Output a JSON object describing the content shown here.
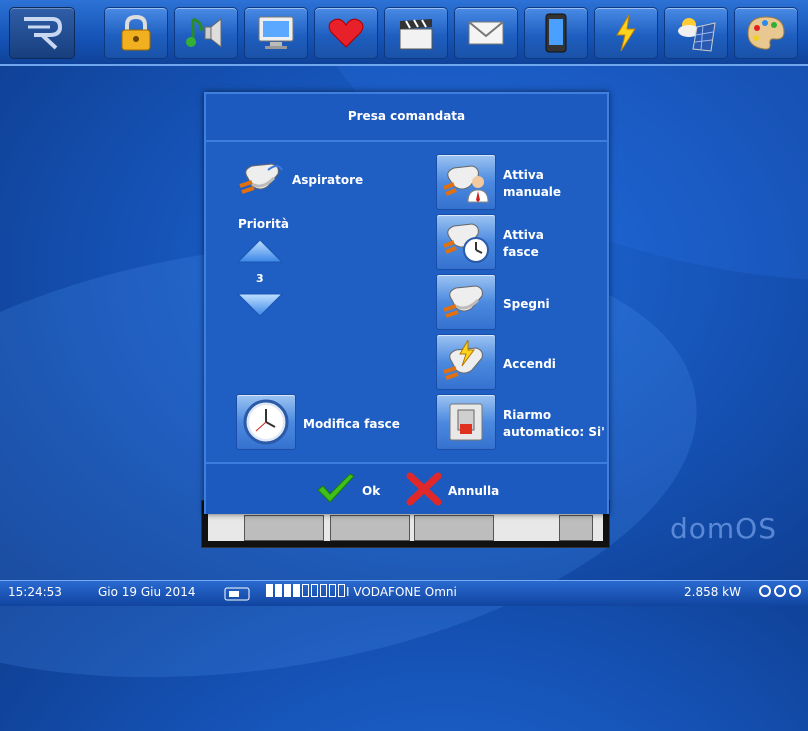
{
  "topbar": {
    "logo": "domos-logo",
    "icons": [
      "lock-icon",
      "music-icon",
      "monitor-icon",
      "heart-icon",
      "clapperboard-icon",
      "mail-icon",
      "phone-icon",
      "lightning-icon",
      "weather-solar-icon",
      "palette-icon"
    ]
  },
  "dialog": {
    "title": "Presa comandata",
    "device_name": "Aspiratore",
    "priority_label": "Priorità",
    "priority_value": "3",
    "schedule_button": "Modifica fasce",
    "actions": [
      {
        "label": "Attiva\nmanuale",
        "icon": "plug-user-icon"
      },
      {
        "label": "Attiva\nfasce",
        "icon": "plug-clock-icon"
      },
      {
        "label": "Spegni",
        "icon": "plug-icon"
      },
      {
        "label": "Accendi",
        "icon": "plug-lightning-icon"
      },
      {
        "label": "Riarmo\nautomatico: Si'",
        "icon": "switch-reset-icon"
      }
    ],
    "ok_label": "Ok",
    "cancel_label": "Annulla"
  },
  "watermark": "domOS",
  "statusbar": {
    "time": "15:24:53",
    "date": "Gio 19 Giu 2014",
    "carrier": "I VODAFONE Omni",
    "power": "2.858 kW",
    "signal_bars_on": 4,
    "signal_bars_total": 9
  },
  "colors": {
    "accent": "#1f5fc4",
    "ok": "#3ec11a",
    "cancel": "#e0282a"
  }
}
